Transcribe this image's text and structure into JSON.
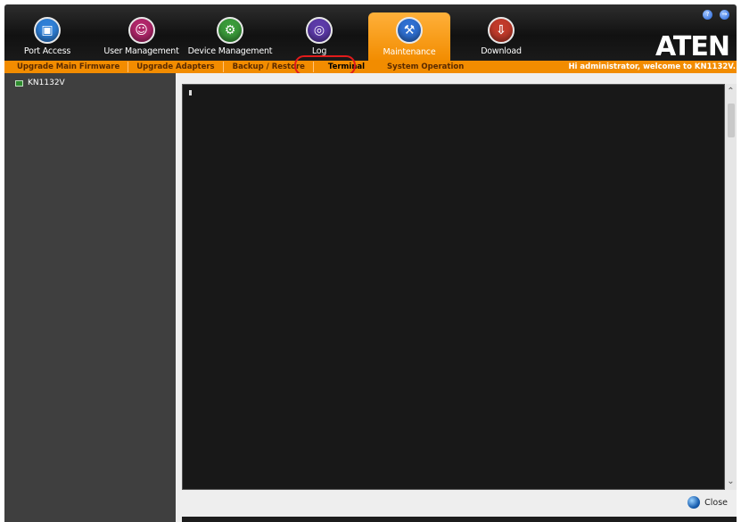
{
  "nav": {
    "items": [
      {
        "label": "Port Access",
        "icon": "port-access-icon",
        "color": "#2f7fd6",
        "glyph": "▣"
      },
      {
        "label": "User Management",
        "icon": "user-management-icon",
        "color": "#b0266a",
        "glyph": "☺"
      },
      {
        "label": "Device Management",
        "icon": "device-management-icon",
        "color": "#3a9a3a",
        "glyph": "⚙"
      },
      {
        "label": "Log",
        "icon": "log-icon",
        "color": "#5c3aa8",
        "glyph": "◎"
      },
      {
        "label": "Maintenance",
        "icon": "maintenance-icon",
        "color": "#2f6fd0",
        "glyph": "⚒"
      },
      {
        "label": "Download",
        "icon": "download-icon",
        "color": "#c03a2a",
        "glyph": "⇩"
      }
    ],
    "active": "Maintenance"
  },
  "brand": {
    "logo_text": "ATEN"
  },
  "subnav": {
    "items": [
      {
        "label": "Upgrade Main Firmware"
      },
      {
        "label": "Upgrade Adapters"
      },
      {
        "label": "Backup / Restore"
      },
      {
        "label": "Terminal"
      },
      {
        "label": "System Operation"
      }
    ],
    "selected": "Terminal"
  },
  "welcome": "Hi administrator, welcome to KN1132V.",
  "sidebar": {
    "device": "KN1132V"
  },
  "main": {
    "close_label": "Close"
  },
  "colors": {
    "accent": "#f28c00",
    "highlight": "#e11b1b",
    "terminal_bg": "#181818"
  }
}
